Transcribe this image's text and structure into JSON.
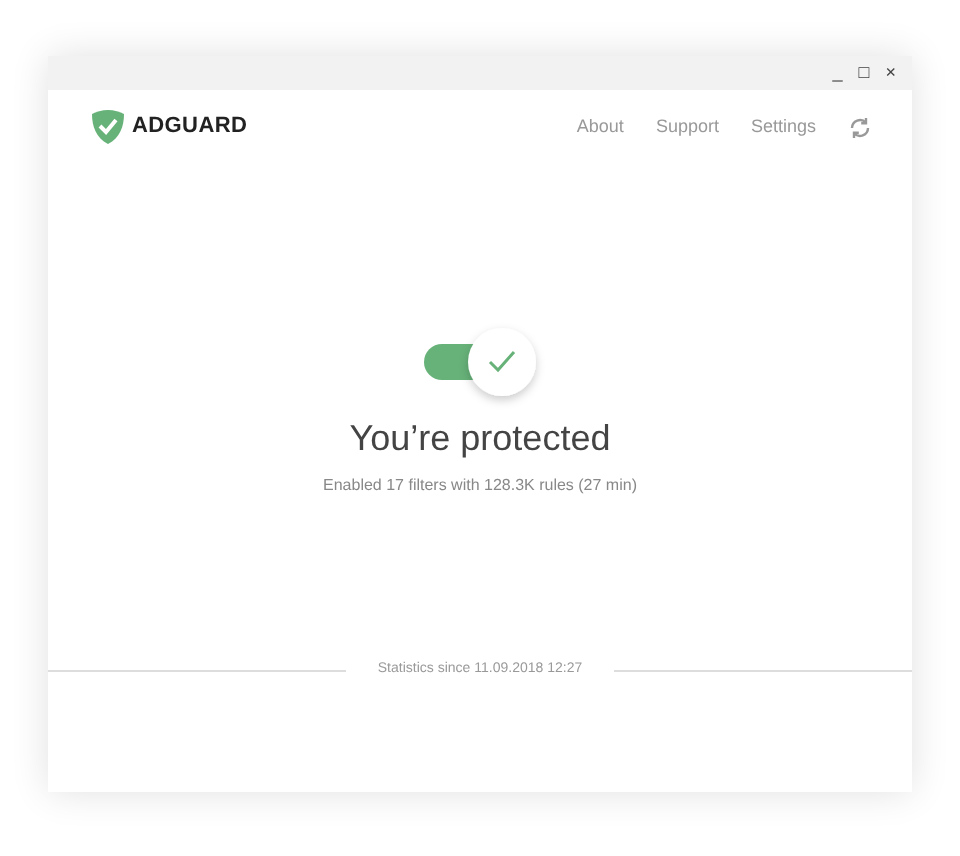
{
  "window": {
    "controls": [
      "_",
      "□",
      "×"
    ]
  },
  "header": {
    "logo": "ADGUARD",
    "nav": [
      "About",
      "Support",
      "Settings"
    ]
  },
  "protection": {
    "on": true,
    "title": "You’re protected",
    "subtitle": "Enabled 17 filters with 128.3K rules (27 min)"
  },
  "statistics": {
    "label": "Statistics since 11.09.2018 12:27"
  }
}
